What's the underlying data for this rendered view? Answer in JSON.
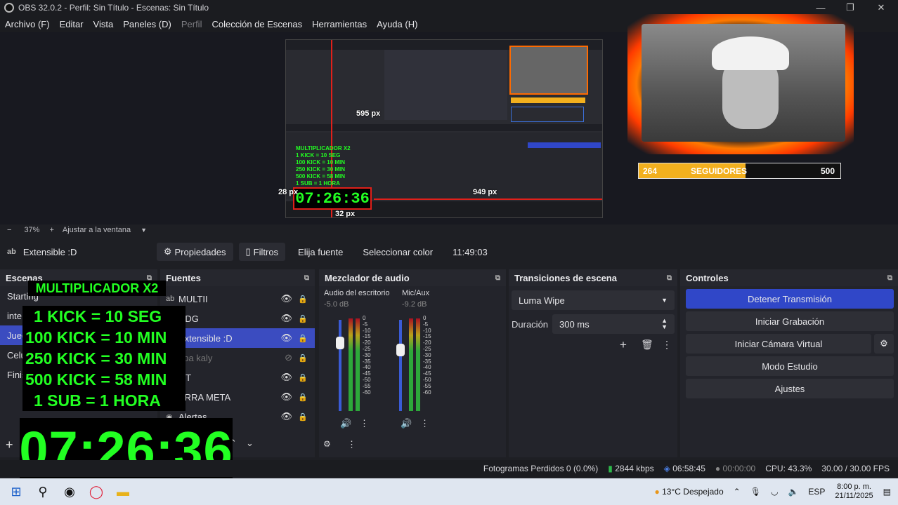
{
  "window": {
    "title": "OBS 32.0.2 - Perfil: Sin Título - Escenas: Sin Título",
    "controls": [
      "—",
      "❐",
      "✕"
    ]
  },
  "menu": [
    "Archivo (F)",
    "Editar",
    "Vista",
    "Paneles (D)",
    "Perfil",
    "Colección de Escenas",
    "Herramientas",
    "Ayuda (H)"
  ],
  "preview": {
    "labels": {
      "px_top": "595 px",
      "px_left": "28 px",
      "px_right": "949 px",
      "px_bottom": "32 px"
    },
    "mini_timer": "07:26:36",
    "mini_lines": [
      "MULTIPLICADOR X2",
      "1 KICK = 10 SEG",
      "100 KICK = 10 MIN",
      "250 KICK = 30 MIN",
      "500 KICK = 58 MIN",
      "1 SUB = 1 HORA"
    ],
    "follow_bar": {
      "current": "264",
      "label": "SEGUIDORES",
      "goal": "500",
      "progress": 0.528
    },
    "zoom": {
      "minus": "−",
      "value": "37%",
      "plus": "+",
      "fit": "Ajustar a la ventana"
    }
  },
  "source_toolbar": {
    "selected": "Extensible :D",
    "buttons": [
      "Propiedades",
      "Filtros",
      "Elija fuente",
      "Seleccionar color"
    ],
    "time": "11:49:03"
  },
  "scenes": {
    "title": "Escenas",
    "items": [
      "Starting",
      "inte",
      "Jueg",
      "Celu",
      "Finis"
    ],
    "selected_index": 2
  },
  "sources": {
    "title": "Fuentes",
    "items": [
      {
        "label": "MULTII",
        "visible": true
      },
      {
        "label": "DDG",
        "visible": true
      },
      {
        "label": "Extensible :D",
        "visible": true
      },
      {
        "label": "opa kaly",
        "visible": false
      },
      {
        "label": "OT",
        "visible": true
      },
      {
        "label": "ARRA META",
        "visible": true
      },
      {
        "label": "Alertas",
        "visible": true
      }
    ],
    "selected_index": 2
  },
  "mixer": {
    "title": "Mezclador de audio",
    "channels": [
      {
        "name": "Audio del escritorio",
        "db": "-5.0 dB",
        "level": 0.75
      },
      {
        "name": "Mic/Aux",
        "db": "-9.2 dB",
        "level": 0.65
      }
    ],
    "scale": [
      "0",
      "-5",
      "-10",
      "-15",
      "-20",
      "-25",
      "-30",
      "-35",
      "-40",
      "-45",
      "-50",
      "-55",
      "-60"
    ]
  },
  "transitions": {
    "title": "Transiciones de escena",
    "selected": "Luma Wipe",
    "duration_label": "Duración",
    "duration_value": "300 ms"
  },
  "controls": {
    "title": "Controles",
    "buttons": [
      "Detener Transmisión",
      "Iniciar Grabación",
      "Iniciar Cámara Virtual",
      "Modo Estudio",
      "Ajustes"
    ]
  },
  "status": {
    "dropped": "Fotogramas Perdidos 0 (0.0%)",
    "bitrate": "2844 kbps",
    "stream_time": "06:58:45",
    "rec_time": "00:00:00",
    "cpu": "CPU: 43.3%",
    "fps": "30.00 / 30.00 FPS"
  },
  "overlay": {
    "title": "MULTIPLICADOR X2",
    "lines": [
      "1 KICK = 10 SEG",
      "100  KICK = 10 MIN",
      "250 KICK = 30 MIN",
      "500 KICK = 58 MIN",
      "1 SUB = 1 HORA"
    ],
    "timer": "07:26:36"
  },
  "taskbar": {
    "weather": "13°C  Despejado",
    "lang": "ESP",
    "time": "8:00 p. m.",
    "date": "21/11/2025"
  }
}
